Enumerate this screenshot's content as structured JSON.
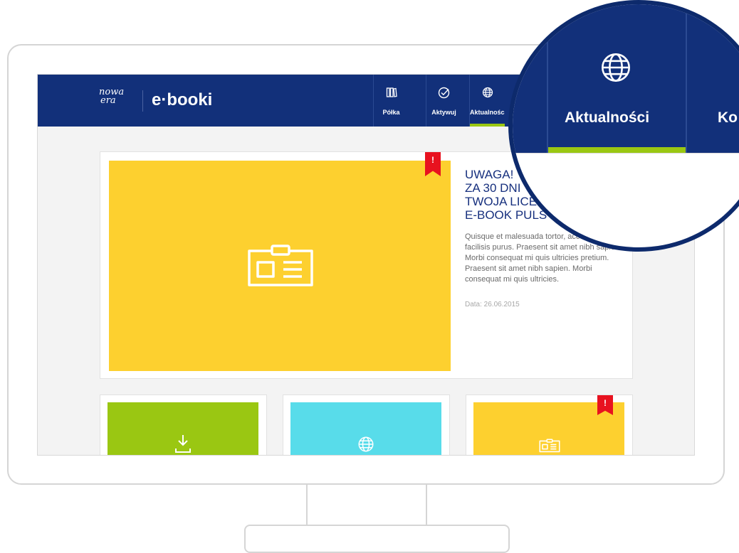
{
  "header": {
    "logo_brand_top": "nowa",
    "logo_brand_bottom": "era",
    "logo_product": "e·booki"
  },
  "nav": {
    "items": [
      {
        "label": "Półka",
        "icon": "books-icon"
      },
      {
        "label": "Aktywuj",
        "icon": "checkmark-circle-icon"
      },
      {
        "label": "Aktualności",
        "icon": "globe-icon",
        "active": true
      }
    ]
  },
  "featured": {
    "badge": "!",
    "title": "UWAGA!\nZA 30 DNI\nTWOJA LICE\nE-BOOK PULS 2",
    "body": "Quisque et malesuada tortor, accumsan facilisis purus. Praesent sit amet nibh sapien. Morbi consequat mi quis ultricies pretium. Praesent sit amet nibh sapien. Morbi consequat mi quis ultricies.",
    "date": "Data: 26.06.2015",
    "image_color": "#fdd02f",
    "image_icon": "id-card-icon"
  },
  "cards": [
    {
      "color": "#9ac712",
      "icon": "download-icon"
    },
    {
      "color": "#58dcea",
      "icon": "globe-icon"
    },
    {
      "color": "#fdd02f",
      "icon": "id-card-icon",
      "badge": "!"
    }
  ],
  "magnifier": {
    "active_label": "Aktualności",
    "next_label_partial": "Ko",
    "accent": "#9ac712"
  },
  "colors": {
    "header_bg": "#12307a",
    "accent_green": "#9ac712",
    "alert_red": "#e8121f",
    "title_blue": "#17307e"
  }
}
